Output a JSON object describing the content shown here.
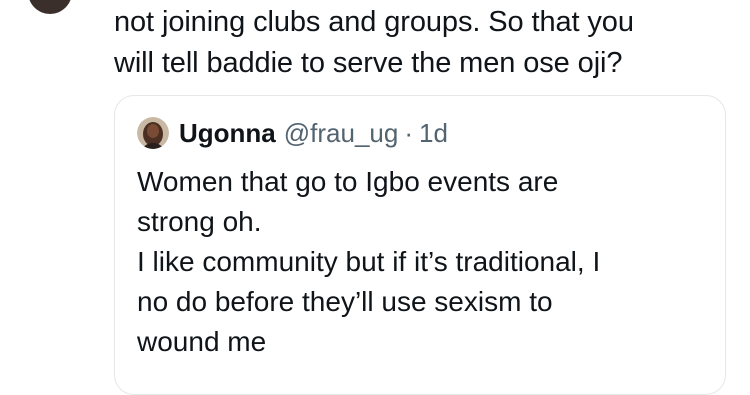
{
  "tweet": {
    "text": "not joining clubs and groups. So that you\nwill tell baddie to serve the men ose oji?"
  },
  "quote": {
    "author_name": "Ugonna",
    "handle": "@frau_ug",
    "separator": "·",
    "time": "1d",
    "text": "Women that go to Igbo events are\nstrong oh.\nI like community but if it’s traditional, I\nno do before they’ll use sexism to\nwound me"
  }
}
